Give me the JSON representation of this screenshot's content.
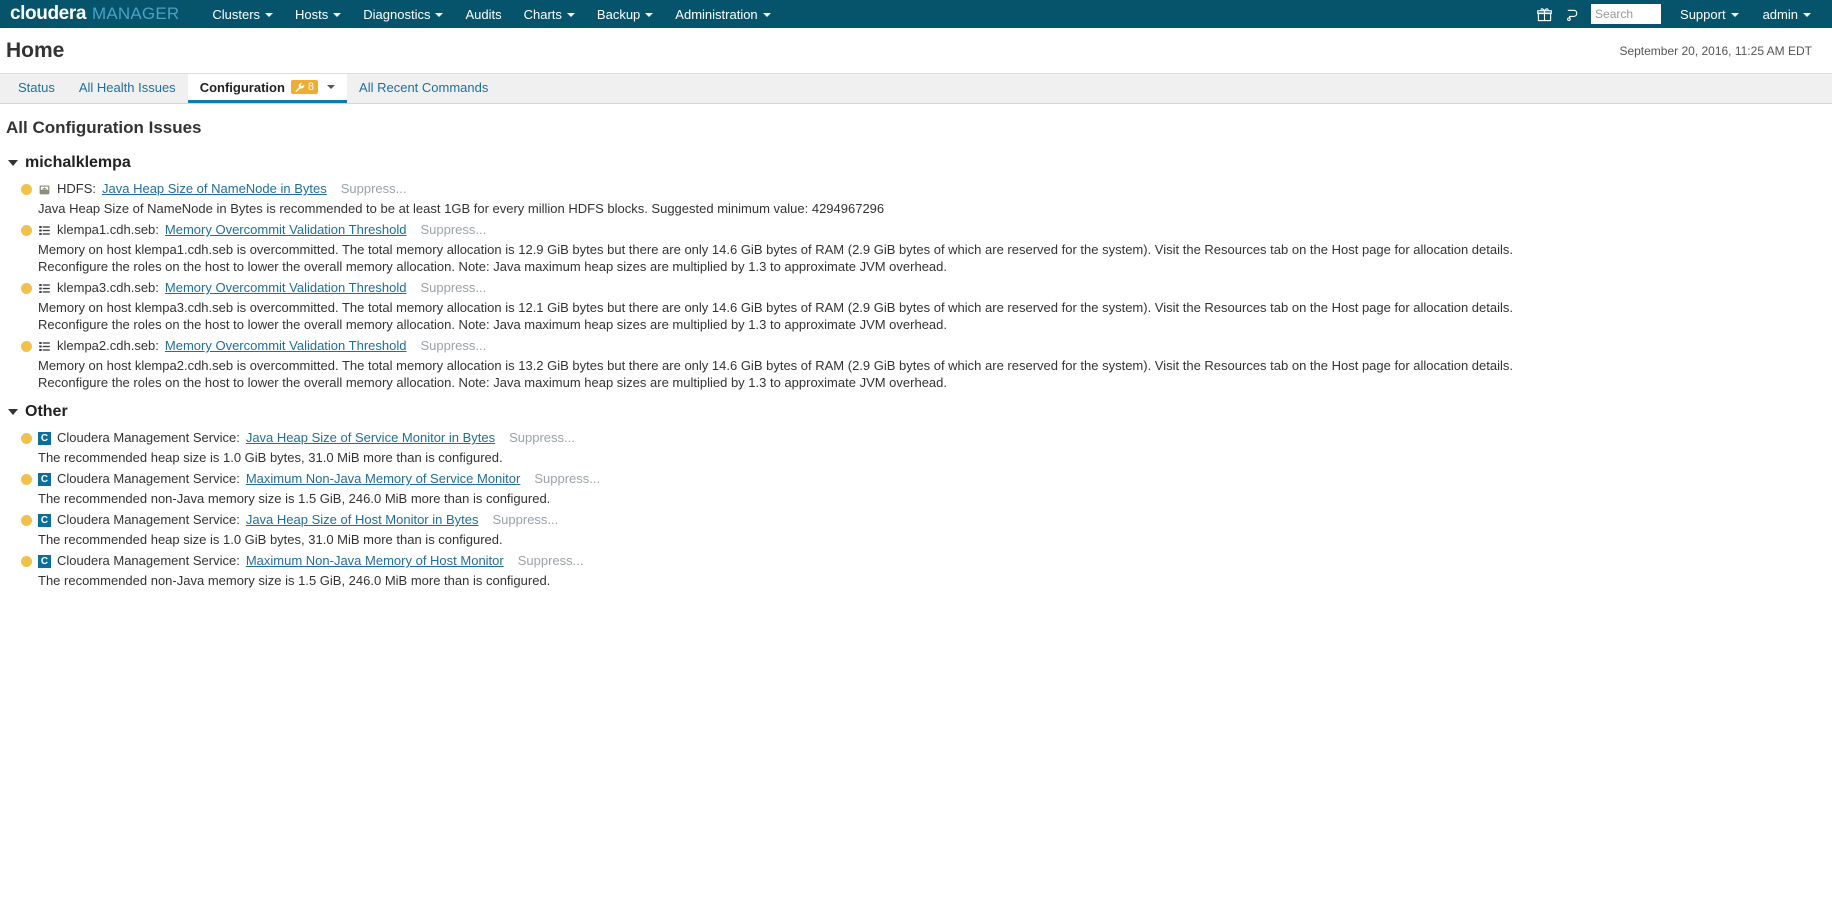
{
  "topnav": {
    "brand_primary": "cloudera",
    "brand_secondary": "MANAGER",
    "items": [
      {
        "label": "Clusters",
        "caret": true
      },
      {
        "label": "Hosts",
        "caret": true
      },
      {
        "label": "Diagnostics",
        "caret": true
      },
      {
        "label": "Audits",
        "caret": false
      },
      {
        "label": "Charts",
        "caret": true
      },
      {
        "label": "Backup",
        "caret": true
      },
      {
        "label": "Administration",
        "caret": true
      }
    ],
    "gift_icon": "gift-icon",
    "notification_icon": "notification-icon",
    "search_placeholder": "Search",
    "search_value": "",
    "support_label": "Support",
    "admin_label": "admin"
  },
  "header": {
    "title": "Home",
    "timestamp": "September 20, 2016, 11:25 AM EDT"
  },
  "tabs": [
    {
      "label": "Status",
      "active": false
    },
    {
      "label": "All Health Issues",
      "active": false
    },
    {
      "label": "Configuration",
      "active": true,
      "badge_count": "8",
      "badge_icon": "wrench-icon"
    },
    {
      "label": "All Recent Commands",
      "active": false
    }
  ],
  "main": {
    "heading": "All Configuration Issues",
    "groups": [
      {
        "name": "michalklempa",
        "issues": [
          {
            "severity": "warning",
            "icon": "hdfs-service-icon",
            "scope": "HDFS:",
            "link": "Java Heap Size of NameNode in Bytes",
            "suppress": "Suppress...",
            "description": "Java Heap Size of NameNode in Bytes is recommended to be at least 1GB for every million HDFS blocks. Suggested minimum value: 4294967296"
          },
          {
            "severity": "warning",
            "icon": "host-icon",
            "scope": "klempa1.cdh.seb:",
            "link": "Memory Overcommit Validation Threshold",
            "suppress": "Suppress...",
            "description": "Memory on host klempa1.cdh.seb is overcommitted. The total memory allocation is 12.9 GiB bytes but there are only 14.6 GiB bytes of RAM (2.9 GiB bytes of which are reserved for the system). Visit the Resources tab on the Host page for allocation details. Reconfigure the roles on the host to lower the overall memory allocation. Note: Java maximum heap sizes are multiplied by 1.3 to approximate JVM overhead."
          },
          {
            "severity": "warning",
            "icon": "host-icon",
            "scope": "klempa3.cdh.seb:",
            "link": "Memory Overcommit Validation Threshold",
            "suppress": "Suppress...",
            "description": "Memory on host klempa3.cdh.seb is overcommitted. The total memory allocation is 12.1 GiB bytes but there are only 14.6 GiB bytes of RAM (2.9 GiB bytes of which are reserved for the system). Visit the Resources tab on the Host page for allocation details. Reconfigure the roles on the host to lower the overall memory allocation. Note: Java maximum heap sizes are multiplied by 1.3 to approximate JVM overhead."
          },
          {
            "severity": "warning",
            "icon": "host-icon",
            "scope": "klempa2.cdh.seb:",
            "link": "Memory Overcommit Validation Threshold",
            "suppress": "Suppress...",
            "description": "Memory on host klempa2.cdh.seb is overcommitted. The total memory allocation is 13.2 GiB bytes but there are only 14.6 GiB bytes of RAM (2.9 GiB bytes of which are reserved for the system). Visit the Resources tab on the Host page for allocation details. Reconfigure the roles on the host to lower the overall memory allocation. Note: Java maximum heap sizes are multiplied by 1.3 to approximate JVM overhead."
          }
        ]
      },
      {
        "name": "Other",
        "issues": [
          {
            "severity": "warning",
            "icon": "cloudera-management-service-icon",
            "scope": "Cloudera Management Service:",
            "link": "Java Heap Size of Service Monitor in Bytes",
            "suppress": "Suppress...",
            "description": "The recommended heap size is 1.0 GiB bytes, 31.0 MiB more than is configured."
          },
          {
            "severity": "warning",
            "icon": "cloudera-management-service-icon",
            "scope": "Cloudera Management Service:",
            "link": "Maximum Non-Java Memory of Service Monitor",
            "suppress": "Suppress...",
            "description": "The recommended non-Java memory size is 1.5 GiB, 246.0 MiB more than is configured."
          },
          {
            "severity": "warning",
            "icon": "cloudera-management-service-icon",
            "scope": "Cloudera Management Service:",
            "link": "Java Heap Size of Host Monitor in Bytes",
            "suppress": "Suppress...",
            "description": "The recommended heap size is 1.0 GiB bytes, 31.0 MiB more than is configured."
          },
          {
            "severity": "warning",
            "icon": "cloudera-management-service-icon",
            "scope": "Cloudera Management Service:",
            "link": "Maximum Non-Java Memory of Host Monitor",
            "suppress": "Suppress...",
            "description": "The recommended non-Java memory size is 1.5 GiB, 246.0 MiB more than is configured."
          }
        ]
      }
    ]
  },
  "colors": {
    "navbar": "#06536c",
    "brand_accent": "#46a3c6",
    "link": "#1f6f9a",
    "warning": "#f2c14b",
    "badge": "#f0ad33",
    "tab_active_underline": "#0b7cb0"
  }
}
